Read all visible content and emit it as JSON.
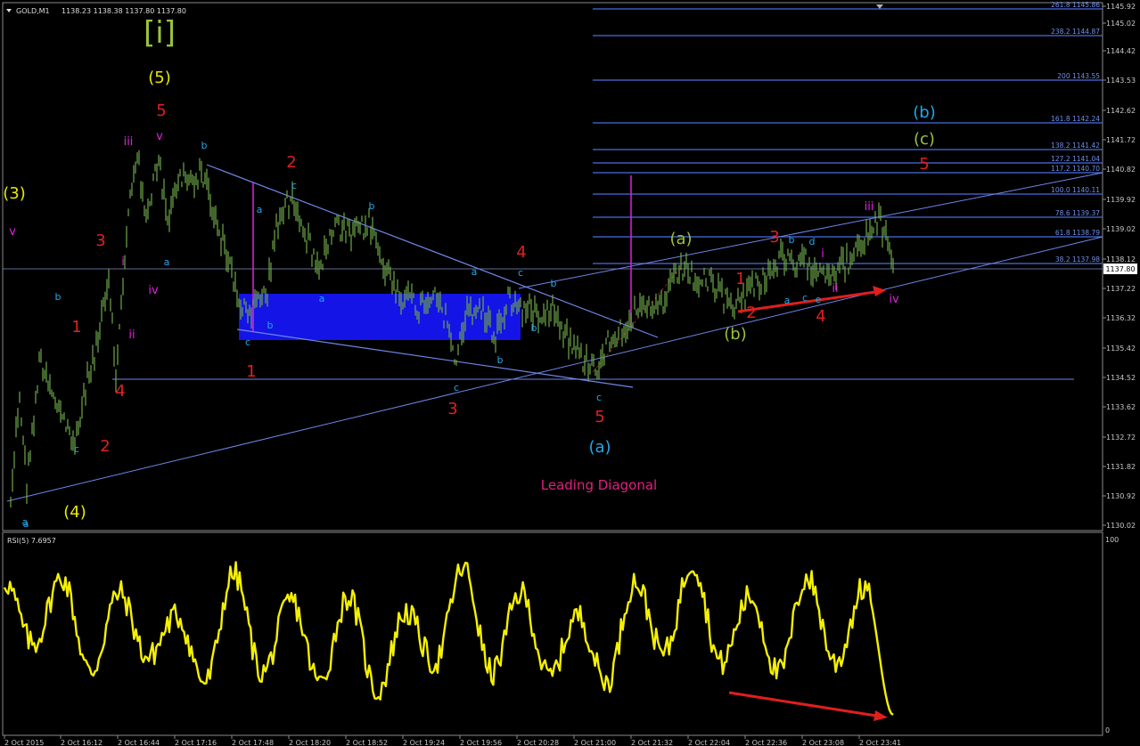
{
  "header": {
    "symbol": "GOLD,M1",
    "ohlc": "1138.23 1138.38 1137.80 1137.80"
  },
  "price_axis": {
    "ticks": [
      "1145.92",
      "1145.02",
      "1144.42",
      "1143.53",
      "1142.62",
      "1141.72",
      "1140.82",
      "1139.92",
      "1139.02",
      "1138.12",
      "1137.22",
      "1136.32",
      "1135.42",
      "1134.52",
      "1133.62",
      "1132.72",
      "1131.82",
      "1130.92",
      "1130.02"
    ],
    "current_price": "1137.80"
  },
  "time_axis": {
    "labels": [
      "2 Oct 2015",
      "2 Oct 16:12",
      "2 Oct 16:44",
      "2 Oct 17:16",
      "2 Oct 17:48",
      "2 Oct 18:20",
      "2 Oct 18:52",
      "2 Oct 19:24",
      "2 Oct 19:56",
      "2 Oct 20:28",
      "2 Oct 21:00",
      "2 Oct 21:32",
      "2 Oct 22:04",
      "2 Oct 22:36",
      "2 Oct 23:08",
      "2 Oct 23:41"
    ]
  },
  "fib_levels": [
    "261.8 1145.86",
    "238.2 1144.87",
    "200 1143.55",
    "161.8 1142.24",
    "138.2 1141.42",
    "127.2 1141.04",
    "117.2 1140.70",
    "100.0 1140.11",
    "78.6 1139.37",
    "61.8 1138.79",
    "38.2 1137.98"
  ],
  "indicator": {
    "title": "RSI(5) 7.6957",
    "max_label": "100",
    "min_label": "0"
  },
  "annotation_text": "Leading Diagonal",
  "wave_labels": [
    {
      "t": "[i]",
      "c": "#9ac23c"
    },
    {
      "t": "(5)",
      "c": "#e8e800"
    },
    {
      "t": "5",
      "c": "#e02020"
    },
    {
      "t": "iii",
      "c": "#e020e0"
    },
    {
      "t": "v",
      "c": "#e020e0"
    },
    {
      "t": "b",
      "c": "#1fa8e8"
    },
    {
      "t": "2",
      "c": "#e02020"
    },
    {
      "t": "c",
      "c": "#1fa8e8"
    },
    {
      "t": "b",
      "c": "#1fa8e8"
    },
    {
      "t": "(3)",
      "c": "#e8e800"
    },
    {
      "t": "v",
      "c": "#e020e0"
    },
    {
      "t": "3",
      "c": "#e02020"
    },
    {
      "t": "i",
      "c": "#e020e0"
    },
    {
      "t": "iv",
      "c": "#e020e0"
    },
    {
      "t": "a",
      "c": "#1fa8e8"
    },
    {
      "t": "a",
      "c": "#1fa8e8"
    },
    {
      "t": "a",
      "c": "#1fa8e8"
    },
    {
      "t": "4",
      "c": "#e02020"
    },
    {
      "t": "c",
      "c": "#1fa8e8"
    },
    {
      "t": "b",
      "c": "#1fa8e8"
    },
    {
      "t": "a",
      "c": "#1fa8e8"
    },
    {
      "t": "b",
      "c": "#1fa8e8"
    },
    {
      "t": "1",
      "c": "#e02020"
    },
    {
      "t": "ii",
      "c": "#e020e0"
    },
    {
      "t": "c",
      "c": "#1fa8e8"
    },
    {
      "t": "b",
      "c": "#1fa8e8"
    },
    {
      "t": "4",
      "c": "#e02020"
    },
    {
      "t": "1",
      "c": "#e02020"
    },
    {
      "t": "2",
      "c": "#e02020"
    },
    {
      "t": "b",
      "c": "#1fa8e8"
    },
    {
      "t": "c",
      "c": "#1fa8e8"
    },
    {
      "t": "3",
      "c": "#e02020"
    },
    {
      "t": "c",
      "c": "#1fa8e8"
    },
    {
      "t": "5",
      "c": "#e02020"
    },
    {
      "t": "(a)",
      "c": "#1fa8e8"
    },
    {
      "t": "c",
      "c": "#1fa8e8"
    },
    {
      "t": "b",
      "c": "#1fa8e8"
    },
    {
      "t": "a",
      "c": "#1fa8e8"
    },
    {
      "t": "(4)",
      "c": "#e8e800"
    },
    {
      "t": "a",
      "c": "#1fa8e8"
    },
    {
      "t": "(a)",
      "c": "#9ac23c"
    },
    {
      "t": "3",
      "c": "#e02020"
    },
    {
      "t": "b",
      "c": "#1fa8e8"
    },
    {
      "t": "d",
      "c": "#1fa8e8"
    },
    {
      "t": "i",
      "c": "#e020e0"
    },
    {
      "t": "1",
      "c": "#e02020"
    },
    {
      "t": "a",
      "c": "#1fa8e8"
    },
    {
      "t": "c",
      "c": "#1fa8e8"
    },
    {
      "t": "e",
      "c": "#1fa8e8"
    },
    {
      "t": "ii",
      "c": "#e020e0"
    },
    {
      "t": "2",
      "c": "#e02020"
    },
    {
      "t": "4",
      "c": "#e02020"
    },
    {
      "t": "(b)",
      "c": "#9ac23c"
    },
    {
      "t": "iii",
      "c": "#e020e0"
    },
    {
      "t": "iv",
      "c": "#e020e0"
    },
    {
      "t": "(b)",
      "c": "#1fa8e8"
    },
    {
      "t": "(c)",
      "c": "#9ac23c"
    },
    {
      "t": "5",
      "c": "#e02020"
    }
  ],
  "colors": {
    "background": "#000000",
    "candles": "#6fa84a",
    "trendlines": "#6f86e8",
    "fib_lines": "#4a6ee0",
    "box": "#1414e6",
    "rsi": "#f5f000",
    "arrow": "#e01e1e",
    "magenta": "#e020e0",
    "grid_text": "#c8c8c8"
  },
  "chart_data": [
    {
      "type": "line",
      "title": "GOLD,M1",
      "ylim": [
        1130.02,
        1145.92
      ],
      "x": [
        "2 Oct 2015",
        "2 Oct 16:12",
        "2 Oct 16:44",
        "2 Oct 17:16",
        "2 Oct 17:48",
        "2 Oct 18:20",
        "2 Oct 18:52",
        "2 Oct 19:24",
        "2 Oct 19:56",
        "2 Oct 20:28",
        "2 Oct 21:00",
        "2 Oct 21:32",
        "2 Oct 22:04",
        "2 Oct 22:36",
        "2 Oct 23:08",
        "2 Oct 23:41"
      ],
      "values": [
        1131.2,
        1133.8,
        1140.5,
        1140.0,
        1136.6,
        1139.2,
        1138.5,
        1136.5,
        1136.1,
        1136.3,
        1135.3,
        1137.4,
        1137.8,
        1137.5,
        1138.0,
        1138.9
      ],
      "current_price": 1137.8,
      "grid": false
    },
    {
      "type": "line",
      "title": "RSI(5) 7.6957",
      "ylim": [
        0,
        100
      ],
      "values": [
        78,
        45,
        80,
        30,
        72,
        38,
        60,
        25,
        82,
        30,
        68,
        25,
        70,
        20,
        62,
        35,
        85,
        30,
        72,
        28,
        60,
        25,
        78,
        40,
        88,
        35,
        70,
        30,
        80,
        35,
        75,
        8
      ]
    }
  ]
}
